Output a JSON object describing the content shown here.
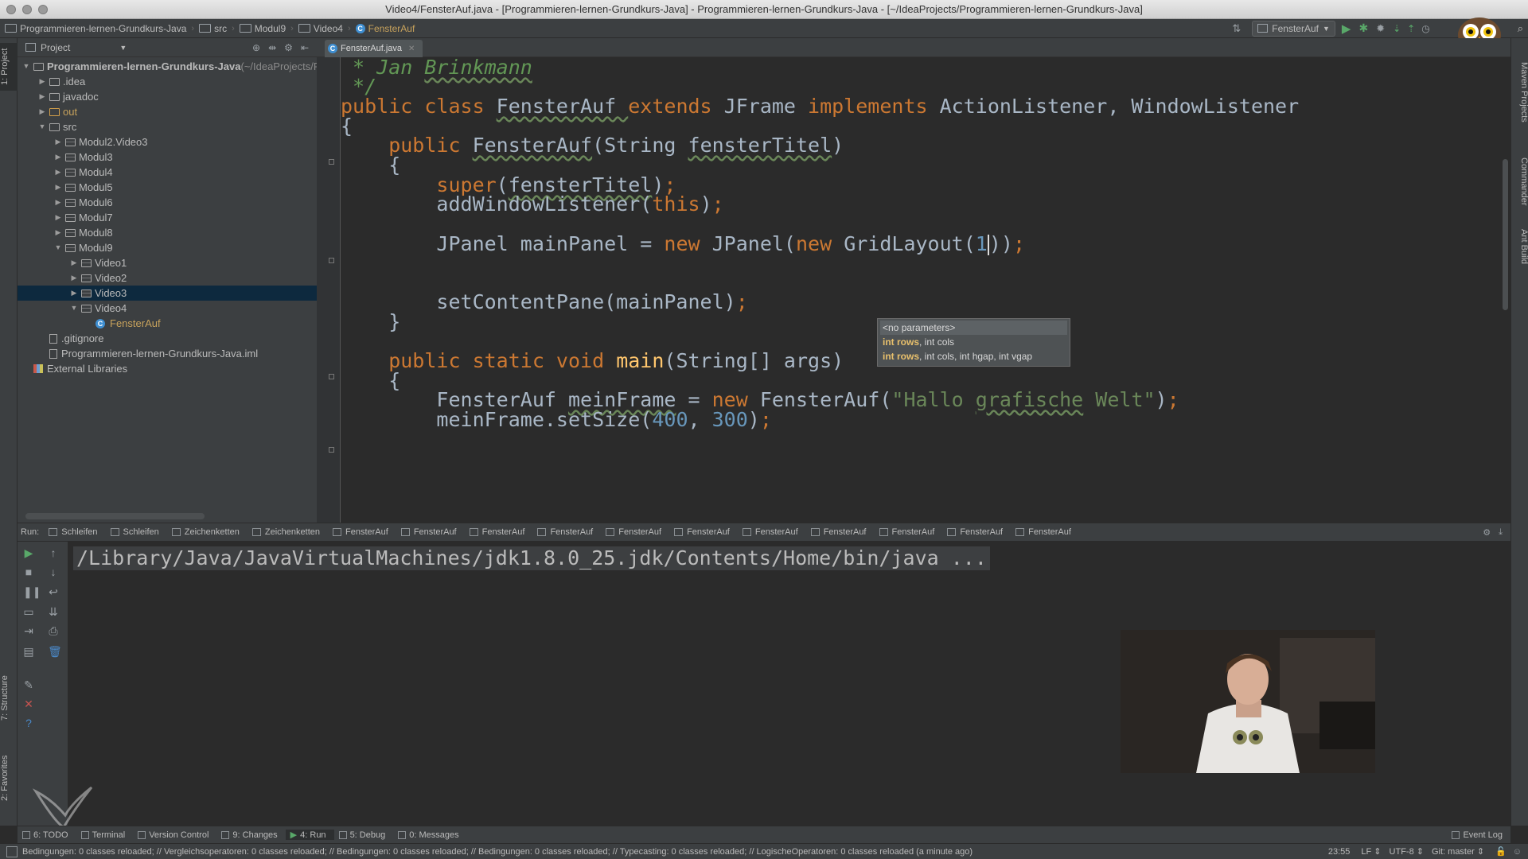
{
  "window": {
    "title": "Video4/FensterAuf.java - [Programmieren-lernen-Grundkurs-Java] - Programmieren-lernen-Grundkurs-Java - [~/IdeaProjects/Programmieren-lernen-Grundkurs-Java]"
  },
  "breadcrumb": [
    "Programmieren-lernen-Grundkurs-Java",
    "src",
    "Modul9",
    "Video4",
    "FensterAuf"
  ],
  "run_config": "FensterAuf",
  "left_strip": {
    "project": "1: Project",
    "structure": "7: Structure",
    "favorites": "2: Favorites"
  },
  "right_strip": {
    "maven": "Maven Projects",
    "commander": "Commander",
    "ant": "Ant Build"
  },
  "project": {
    "header": "Project",
    "tree": [
      {
        "label": "Programmieren-lernen-Grundkurs-Java",
        "suffix": " (~/IdeaProjects/P",
        "indent": 0,
        "arrow": "▼",
        "icon": "folder-icon",
        "bold": true
      },
      {
        "label": ".idea",
        "indent": 1,
        "arrow": "▶",
        "icon": "folder-icon"
      },
      {
        "label": "javadoc",
        "indent": 1,
        "arrow": "▶",
        "icon": "folder-icon"
      },
      {
        "label": "out",
        "indent": 1,
        "arrow": "▶",
        "icon": "folder-icon",
        "color": "orange"
      },
      {
        "label": "src",
        "indent": 1,
        "arrow": "▼",
        "icon": "folder-icon"
      },
      {
        "label": "Modul2.Video3",
        "indent": 2,
        "arrow": "▶",
        "icon": "package-icon"
      },
      {
        "label": "Modul3",
        "indent": 2,
        "arrow": "▶",
        "icon": "package-icon"
      },
      {
        "label": "Modul4",
        "indent": 2,
        "arrow": "▶",
        "icon": "package-icon"
      },
      {
        "label": "Modul5",
        "indent": 2,
        "arrow": "▶",
        "icon": "package-icon"
      },
      {
        "label": "Modul6",
        "indent": 2,
        "arrow": "▶",
        "icon": "package-icon"
      },
      {
        "label": "Modul7",
        "indent": 2,
        "arrow": "▶",
        "icon": "package-icon"
      },
      {
        "label": "Modul8",
        "indent": 2,
        "arrow": "▶",
        "icon": "package-icon"
      },
      {
        "label": "Modul9",
        "indent": 2,
        "arrow": "▼",
        "icon": "package-icon"
      },
      {
        "label": "Video1",
        "indent": 3,
        "arrow": "▶",
        "icon": "package-icon"
      },
      {
        "label": "Video2",
        "indent": 3,
        "arrow": "▶",
        "icon": "package-icon"
      },
      {
        "label": "Video3",
        "indent": 3,
        "arrow": "▶",
        "icon": "package-icon",
        "selected": true
      },
      {
        "label": "Video4",
        "indent": 3,
        "arrow": "▼",
        "icon": "package-icon"
      },
      {
        "label": "FensterAuf",
        "indent": 4,
        "arrow": "",
        "icon": "java-class-icon",
        "color": "orange"
      },
      {
        "label": ".gitignore",
        "indent": 1,
        "arrow": "",
        "icon": "file-icon"
      },
      {
        "label": "Programmieren-lernen-Grundkurs-Java.iml",
        "indent": 1,
        "arrow": "",
        "icon": "file-icon"
      },
      {
        "label": "External Libraries",
        "indent": 0,
        "arrow": "",
        "icon": "library-icon"
      }
    ]
  },
  "editor": {
    "tab": "FensterAuf.java",
    "lines": [
      {
        "tokens": [
          {
            "t": " * Jan ",
            "c": "cm"
          },
          {
            "t": "Brinkmann",
            "c": "cm wavy"
          }
        ]
      },
      {
        "tokens": [
          {
            "t": " */",
            "c": "cm"
          }
        ]
      },
      {
        "tokens": [
          {
            "t": "public class ",
            "c": "kw"
          },
          {
            "t": "FensterAuf ",
            "c": "wavy"
          },
          {
            "t": "extends ",
            "c": "kw"
          },
          {
            "t": "JFrame "
          },
          {
            "t": "implements ",
            "c": "kw"
          },
          {
            "t": "ActionListener, WindowListener"
          }
        ]
      },
      {
        "tokens": [
          {
            "t": "{"
          }
        ]
      },
      {
        "tokens": [
          {
            "t": "    public ",
            "c": "kw"
          },
          {
            "t": "FensterAuf",
            "c": "wavy"
          },
          {
            "t": "(String "
          },
          {
            "t": "fensterTitel",
            "c": "wavy"
          },
          {
            "t": ")"
          }
        ]
      },
      {
        "tokens": [
          {
            "t": "    {"
          }
        ]
      },
      {
        "tokens": [
          {
            "t": "        super",
            "c": "kw"
          },
          {
            "t": "("
          },
          {
            "t": "fensterTitel",
            "c": "wavy"
          },
          {
            "t": ")"
          },
          {
            "t": ";",
            "c": "kw"
          }
        ]
      },
      {
        "tokens": [
          {
            "t": "        addWindowListener("
          },
          {
            "t": "this",
            "c": "kw"
          },
          {
            "t": ")"
          },
          {
            "t": ";",
            "c": "kw"
          }
        ]
      },
      {
        "tokens": [
          {
            "t": ""
          }
        ]
      },
      {
        "tokens": [
          {
            "t": "        JPanel mainPanel = "
          },
          {
            "t": "new ",
            "c": "kw"
          },
          {
            "t": "JPanel("
          },
          {
            "t": "new ",
            "c": "kw"
          },
          {
            "t": "GridLayout("
          },
          {
            "t": "1",
            "c": "num"
          },
          {
            "t": "))"
          },
          {
            "t": ";",
            "c": "kw"
          }
        ]
      },
      {
        "tokens": [
          {
            "t": ""
          }
        ]
      },
      {
        "tokens": [
          {
            "t": ""
          }
        ]
      },
      {
        "tokens": [
          {
            "t": "        setContentPane(mainPanel)"
          },
          {
            "t": ";",
            "c": "kw"
          }
        ]
      },
      {
        "tokens": [
          {
            "t": "    }"
          }
        ]
      },
      {
        "tokens": [
          {
            "t": ""
          }
        ]
      },
      {
        "tokens": [
          {
            "t": "    public static void ",
            "c": "kw"
          },
          {
            "t": "main",
            "c": "fn"
          },
          {
            "t": "(String[] args)"
          }
        ]
      },
      {
        "tokens": [
          {
            "t": "    {"
          }
        ]
      },
      {
        "tokens": [
          {
            "t": "        FensterAuf "
          },
          {
            "t": "meinFrame",
            "c": "wavy"
          },
          {
            "t": " = "
          },
          {
            "t": "new ",
            "c": "kw"
          },
          {
            "t": "FensterAuf("
          },
          {
            "t": "\"Hallo ",
            "c": "str"
          },
          {
            "t": "grafische",
            "c": "str wavy"
          },
          {
            "t": " Welt\"",
            "c": "str"
          },
          {
            "t": ")"
          },
          {
            "t": ";",
            "c": "kw"
          }
        ]
      },
      {
        "tokens": [
          {
            "t": "        meinFrame.setSize("
          },
          {
            "t": "400",
            "c": "num"
          },
          {
            "t": ", "
          },
          {
            "t": "300",
            "c": "num"
          },
          {
            "t": ")"
          },
          {
            "t": ";",
            "c": "kw"
          }
        ]
      }
    ],
    "param_popup": [
      {
        "bold": "",
        "rest": "<no parameters>"
      },
      {
        "bold": "int rows",
        "rest": ", int cols"
      },
      {
        "bold": "int rows",
        "rest": ", int cols, int hgap, int vgap"
      }
    ]
  },
  "run": {
    "label": "Run:",
    "tabs": [
      "Schleifen",
      "Schleifen",
      "Zeichenketten",
      "Zeichenketten",
      "FensterAuf",
      "FensterAuf",
      "FensterAuf",
      "FensterAuf",
      "FensterAuf",
      "FensterAuf",
      "FensterAuf",
      "FensterAuf",
      "FensterAuf",
      "FensterAuf",
      "FensterAuf"
    ],
    "console": "/Library/Java/JavaVirtualMachines/jdk1.8.0_25.jdk/Contents/Home/bin/java ..."
  },
  "bottom_tools": [
    {
      "label": "6: TODO"
    },
    {
      "label": "Terminal"
    },
    {
      "label": "Version Control"
    },
    {
      "label": "9: Changes"
    },
    {
      "label": "4: Run",
      "active": true
    },
    {
      "label": "5: Debug"
    },
    {
      "label": "0: Messages"
    }
  ],
  "event_log": "Event Log",
  "status": {
    "message": "Bedingungen: 0 classes reloaded; // Vergleichsoperatoren: 0 classes reloaded; // Bedingungen: 0 classes reloaded; // Bedingungen: 0 classes reloaded; // Typecasting: 0 classes reloaded; // LogischeOperatoren: 0 classes reloaded (a minute ago)",
    "position": "23:55",
    "line_sep": "LF",
    "encoding": "UTF-8",
    "vcs": "Git: master"
  },
  "colors": {
    "accent": "#0d293e",
    "keyword": "#cc7832",
    "string": "#6a8759",
    "number": "#6897bb",
    "comment": "#629755"
  }
}
